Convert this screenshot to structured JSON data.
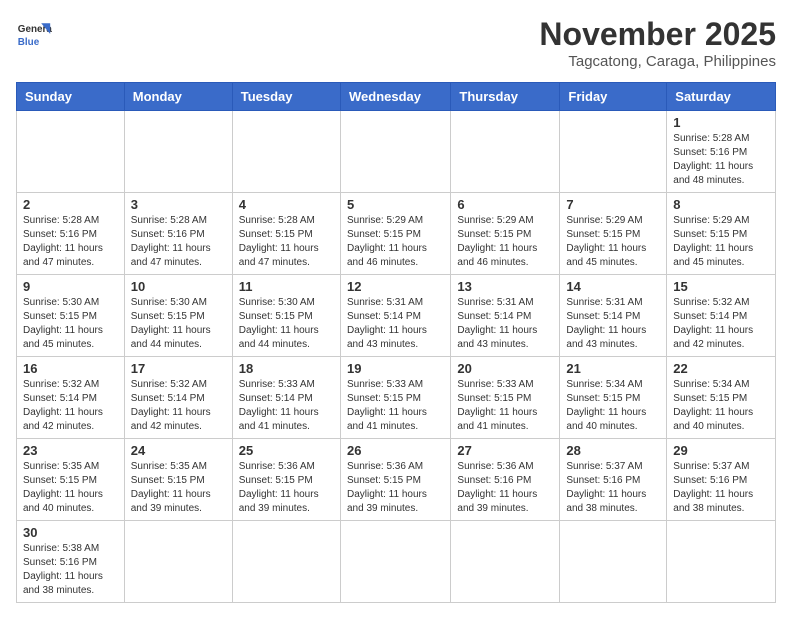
{
  "header": {
    "logo_general": "General",
    "logo_blue": "Blue",
    "month_title": "November 2025",
    "location": "Tagcatong, Caraga, Philippines"
  },
  "days_of_week": [
    "Sunday",
    "Monday",
    "Tuesday",
    "Wednesday",
    "Thursday",
    "Friday",
    "Saturday"
  ],
  "weeks": [
    [
      {
        "day": "",
        "info": ""
      },
      {
        "day": "",
        "info": ""
      },
      {
        "day": "",
        "info": ""
      },
      {
        "day": "",
        "info": ""
      },
      {
        "day": "",
        "info": ""
      },
      {
        "day": "",
        "info": ""
      },
      {
        "day": "1",
        "info": "Sunrise: 5:28 AM\nSunset: 5:16 PM\nDaylight: 11 hours\nand 48 minutes."
      }
    ],
    [
      {
        "day": "2",
        "info": "Sunrise: 5:28 AM\nSunset: 5:16 PM\nDaylight: 11 hours\nand 47 minutes."
      },
      {
        "day": "3",
        "info": "Sunrise: 5:28 AM\nSunset: 5:16 PM\nDaylight: 11 hours\nand 47 minutes."
      },
      {
        "day": "4",
        "info": "Sunrise: 5:28 AM\nSunset: 5:15 PM\nDaylight: 11 hours\nand 47 minutes."
      },
      {
        "day": "5",
        "info": "Sunrise: 5:29 AM\nSunset: 5:15 PM\nDaylight: 11 hours\nand 46 minutes."
      },
      {
        "day": "6",
        "info": "Sunrise: 5:29 AM\nSunset: 5:15 PM\nDaylight: 11 hours\nand 46 minutes."
      },
      {
        "day": "7",
        "info": "Sunrise: 5:29 AM\nSunset: 5:15 PM\nDaylight: 11 hours\nand 45 minutes."
      },
      {
        "day": "8",
        "info": "Sunrise: 5:29 AM\nSunset: 5:15 PM\nDaylight: 11 hours\nand 45 minutes."
      }
    ],
    [
      {
        "day": "9",
        "info": "Sunrise: 5:30 AM\nSunset: 5:15 PM\nDaylight: 11 hours\nand 45 minutes."
      },
      {
        "day": "10",
        "info": "Sunrise: 5:30 AM\nSunset: 5:15 PM\nDaylight: 11 hours\nand 44 minutes."
      },
      {
        "day": "11",
        "info": "Sunrise: 5:30 AM\nSunset: 5:15 PM\nDaylight: 11 hours\nand 44 minutes."
      },
      {
        "day": "12",
        "info": "Sunrise: 5:31 AM\nSunset: 5:14 PM\nDaylight: 11 hours\nand 43 minutes."
      },
      {
        "day": "13",
        "info": "Sunrise: 5:31 AM\nSunset: 5:14 PM\nDaylight: 11 hours\nand 43 minutes."
      },
      {
        "day": "14",
        "info": "Sunrise: 5:31 AM\nSunset: 5:14 PM\nDaylight: 11 hours\nand 43 minutes."
      },
      {
        "day": "15",
        "info": "Sunrise: 5:32 AM\nSunset: 5:14 PM\nDaylight: 11 hours\nand 42 minutes."
      }
    ],
    [
      {
        "day": "16",
        "info": "Sunrise: 5:32 AM\nSunset: 5:14 PM\nDaylight: 11 hours\nand 42 minutes."
      },
      {
        "day": "17",
        "info": "Sunrise: 5:32 AM\nSunset: 5:14 PM\nDaylight: 11 hours\nand 42 minutes."
      },
      {
        "day": "18",
        "info": "Sunrise: 5:33 AM\nSunset: 5:14 PM\nDaylight: 11 hours\nand 41 minutes."
      },
      {
        "day": "19",
        "info": "Sunrise: 5:33 AM\nSunset: 5:15 PM\nDaylight: 11 hours\nand 41 minutes."
      },
      {
        "day": "20",
        "info": "Sunrise: 5:33 AM\nSunset: 5:15 PM\nDaylight: 11 hours\nand 41 minutes."
      },
      {
        "day": "21",
        "info": "Sunrise: 5:34 AM\nSunset: 5:15 PM\nDaylight: 11 hours\nand 40 minutes."
      },
      {
        "day": "22",
        "info": "Sunrise: 5:34 AM\nSunset: 5:15 PM\nDaylight: 11 hours\nand 40 minutes."
      }
    ],
    [
      {
        "day": "23",
        "info": "Sunrise: 5:35 AM\nSunset: 5:15 PM\nDaylight: 11 hours\nand 40 minutes."
      },
      {
        "day": "24",
        "info": "Sunrise: 5:35 AM\nSunset: 5:15 PM\nDaylight: 11 hours\nand 39 minutes."
      },
      {
        "day": "25",
        "info": "Sunrise: 5:36 AM\nSunset: 5:15 PM\nDaylight: 11 hours\nand 39 minutes."
      },
      {
        "day": "26",
        "info": "Sunrise: 5:36 AM\nSunset: 5:15 PM\nDaylight: 11 hours\nand 39 minutes."
      },
      {
        "day": "27",
        "info": "Sunrise: 5:36 AM\nSunset: 5:16 PM\nDaylight: 11 hours\nand 39 minutes."
      },
      {
        "day": "28",
        "info": "Sunrise: 5:37 AM\nSunset: 5:16 PM\nDaylight: 11 hours\nand 38 minutes."
      },
      {
        "day": "29",
        "info": "Sunrise: 5:37 AM\nSunset: 5:16 PM\nDaylight: 11 hours\nand 38 minutes."
      }
    ],
    [
      {
        "day": "30",
        "info": "Sunrise: 5:38 AM\nSunset: 5:16 PM\nDaylight: 11 hours\nand 38 minutes."
      },
      {
        "day": "",
        "info": ""
      },
      {
        "day": "",
        "info": ""
      },
      {
        "day": "",
        "info": ""
      },
      {
        "day": "",
        "info": ""
      },
      {
        "day": "",
        "info": ""
      },
      {
        "day": "",
        "info": ""
      }
    ]
  ]
}
